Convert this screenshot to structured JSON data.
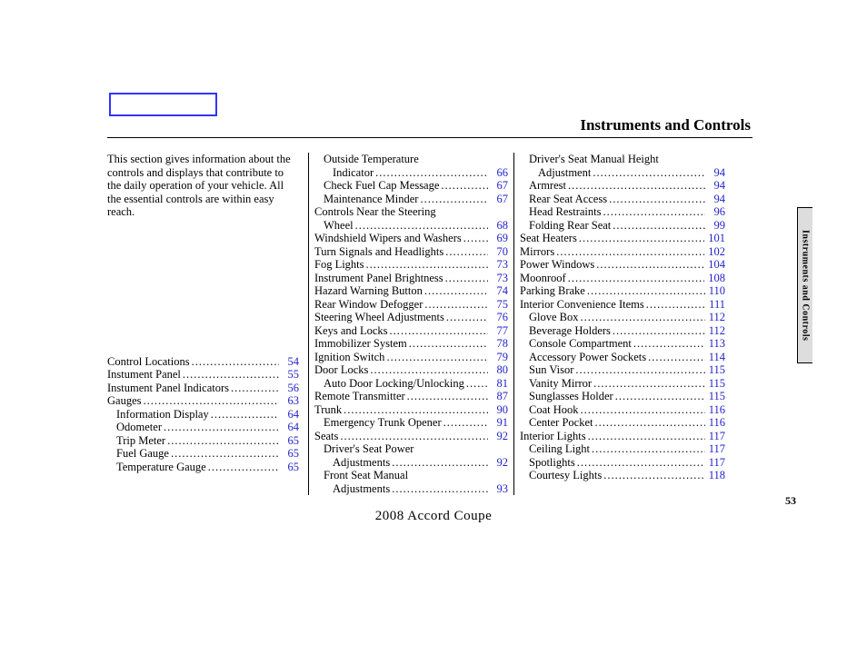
{
  "section_title": "Instruments and Controls",
  "side_tab": "Instruments and Controls",
  "page_number": "53",
  "footer": "2008  Accord  Coupe",
  "intro": "This section gives information about the controls and displays that contribute to the daily operation of your vehicle. All the essential controls are within easy reach.",
  "columns": [
    {
      "entries": [
        {
          "label": "Control Locations",
          "page": "54",
          "indent": 0
        },
        {
          "label": "Instument Panel",
          "page": "55",
          "indent": 0
        },
        {
          "label": "Instument Panel Indicators",
          "page": "56",
          "indent": 0
        },
        {
          "label": "Gauges",
          "page": "63",
          "indent": 0
        },
        {
          "label": "Information Display",
          "page": "64",
          "indent": 1
        },
        {
          "label": "Odometer",
          "page": "64",
          "indent": 1
        },
        {
          "label": "Trip Meter",
          "page": "65",
          "indent": 1
        },
        {
          "label": "Fuel Gauge",
          "page": "65",
          "indent": 1
        },
        {
          "label": "Temperature Gauge",
          "page": "65",
          "indent": 1
        }
      ]
    },
    {
      "entries": [
        {
          "label_pre": "Outside Temperature",
          "label": "Indicator",
          "page": "66",
          "indent": 1,
          "wrap": true
        },
        {
          "label": "Check Fuel Cap Message",
          "page": "67",
          "indent": 1
        },
        {
          "label": "Maintenance Minder",
          "page": "67",
          "indent": 1
        },
        {
          "label_pre": "Controls Near the Steering",
          "label": "Wheel",
          "page": "68",
          "indent": 0,
          "wrap": true,
          "wrap_indent": 1
        },
        {
          "label": "Windshield Wipers and Washers",
          "page": "69",
          "indent": 0
        },
        {
          "label": "Turn Signals and Headlights",
          "page": "70",
          "indent": 0
        },
        {
          "label": "Fog Lights",
          "page": "73",
          "indent": 0
        },
        {
          "label": "Instrument Panel Brightness",
          "page": "73",
          "indent": 0
        },
        {
          "label": "Hazard Warning Button",
          "page": "74",
          "indent": 0
        },
        {
          "label": "Rear Window Defogger",
          "page": "75",
          "indent": 0
        },
        {
          "label": "Steering Wheel Adjustments",
          "page": "76",
          "indent": 0
        },
        {
          "label": "Keys and Locks",
          "page": "77",
          "indent": 0
        },
        {
          "label": "Immobilizer System",
          "page": "78",
          "indent": 0
        },
        {
          "label": "Ignition Switch",
          "page": "79",
          "indent": 0
        },
        {
          "label": "Door Locks",
          "page": "80",
          "indent": 0
        },
        {
          "label": "Auto Door Locking/Unlocking",
          "page": "81",
          "indent": 1
        },
        {
          "label": "Remote Transmitter",
          "page": "87",
          "indent": 0
        },
        {
          "label": "Trunk",
          "page": "90",
          "indent": 0
        },
        {
          "label": "Emergency Trunk Opener",
          "page": "91",
          "indent": 1
        },
        {
          "label": "Seats",
          "page": "92",
          "indent": 0
        },
        {
          "label_pre": "Driver's Seat Power",
          "label": "Adjustments",
          "page": "92",
          "indent": 1,
          "wrap": true,
          "wrap_indent": 2
        },
        {
          "label_pre": "Front Seat Manual",
          "label": "Adjustments",
          "page": "93",
          "indent": 1,
          "wrap": true,
          "wrap_indent": 2
        }
      ]
    },
    {
      "entries": [
        {
          "label_pre": "Driver's Seat Manual Height",
          "label": "Adjustment",
          "page": "94",
          "indent": 1,
          "wrap": true,
          "wrap_indent": 2
        },
        {
          "label": "Armrest",
          "page": "94",
          "indent": 1
        },
        {
          "label": "Rear Seat Access",
          "page": "94",
          "indent": 1
        },
        {
          "label": "Head Restraints",
          "page": "96",
          "indent": 1
        },
        {
          "label": "Folding Rear Seat",
          "page": "99",
          "indent": 1
        },
        {
          "label": "Seat Heaters",
          "page": "101",
          "indent": 0
        },
        {
          "label": "Mirrors",
          "page": "102",
          "indent": 0
        },
        {
          "label": "Power Windows",
          "page": "104",
          "indent": 0
        },
        {
          "label": "Moonroof",
          "page": "108",
          "indent": 0
        },
        {
          "label": "Parking Brake",
          "page": "110",
          "indent": 0
        },
        {
          "label": "Interior Convenience Items",
          "page": "111",
          "indent": 0
        },
        {
          "label": "Glove Box",
          "page": "112",
          "indent": 1
        },
        {
          "label": "Beverage Holders",
          "page": "112",
          "indent": 1
        },
        {
          "label": "Console Compartment",
          "page": "113",
          "indent": 1
        },
        {
          "label": "Accessory Power Sockets",
          "page": "114",
          "indent": 1
        },
        {
          "label": "Sun Visor",
          "page": "115",
          "indent": 1
        },
        {
          "label": "Vanity Mirror",
          "page": "115",
          "indent": 1
        },
        {
          "label": "Sunglasses Holder",
          "page": "115",
          "indent": 1
        },
        {
          "label": "Coat Hook",
          "page": "116",
          "indent": 1
        },
        {
          "label": "Center Pocket",
          "page": "116",
          "indent": 1
        },
        {
          "label": "Interior Lights",
          "page": "117",
          "indent": 0
        },
        {
          "label": "Ceiling Light",
          "page": "117",
          "indent": 1
        },
        {
          "label": "Spotlights",
          "page": "117",
          "indent": 1
        },
        {
          "label": "Courtesy Lights",
          "page": "118",
          "indent": 1
        }
      ]
    }
  ]
}
